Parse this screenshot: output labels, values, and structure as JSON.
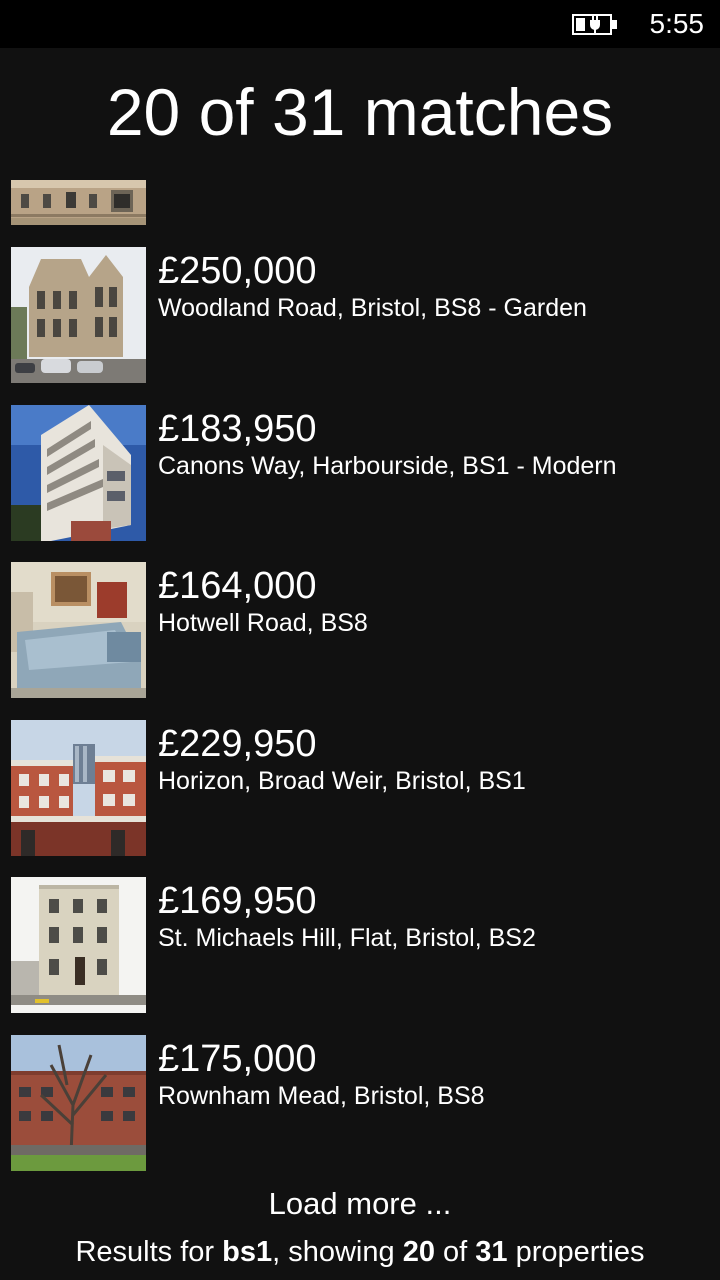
{
  "status_bar": {
    "time": "5:55",
    "battery_icon": "battery-charging-icon"
  },
  "header": {
    "title": "20 of 31 matches"
  },
  "listings": [
    {
      "price": "£250,000",
      "address": "Woodland Road, Bristol, BS8 - Garden"
    },
    {
      "price": "£183,950",
      "address": "Canons Way, Harbourside, BS1 - Modern"
    },
    {
      "price": "£164,000",
      "address": "Hotwell Road, BS8"
    },
    {
      "price": "£229,950",
      "address": "Horizon, Broad Weir, Bristol, BS1"
    },
    {
      "price": "£169,950",
      "address": "St. Michaels Hill, Flat, Bristol, BS2"
    },
    {
      "price": "£175,000",
      "address": "Rownham Mead, Bristol, BS8"
    }
  ],
  "footer": {
    "load_more_label": "Load more ...",
    "results_prefix": "Results for ",
    "query": "bs1",
    "results_middle": ", showing ",
    "shown_count": "20",
    "results_of": " of ",
    "total_count": "31",
    "results_suffix": " properties"
  },
  "colors": {
    "background": "#111111",
    "status_bar": "#000000",
    "text": "#ffffff"
  }
}
